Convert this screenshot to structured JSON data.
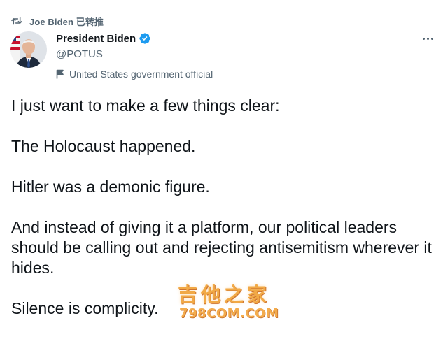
{
  "retweet": {
    "icon": "retweet-icon",
    "text": "Joe Biden 已转推"
  },
  "author": {
    "display_name": "President Biden",
    "handle": "@POTUS",
    "verified_icon": "verified-badge-icon",
    "label_icon": "flag-icon",
    "label": "United States government official",
    "avatar_icon": "avatar-photo"
  },
  "menu": {
    "icon": "more-options-icon"
  },
  "tweet": {
    "paragraphs": [
      "I just want to make a few things clear:",
      "The Holocaust happened.",
      "Hitler was a demonic figure.",
      "And instead of giving it a platform, our political leaders should be calling out and rejecting antisemitism wherever it hides.",
      "Silence is complicity."
    ]
  },
  "watermark": {
    "chinese": "吉他之家",
    "site": "798COM.COM"
  },
  "colors": {
    "text": "#0f1419",
    "muted": "#536471",
    "verified": "#1d9bf0",
    "watermark": "#f0a033"
  }
}
